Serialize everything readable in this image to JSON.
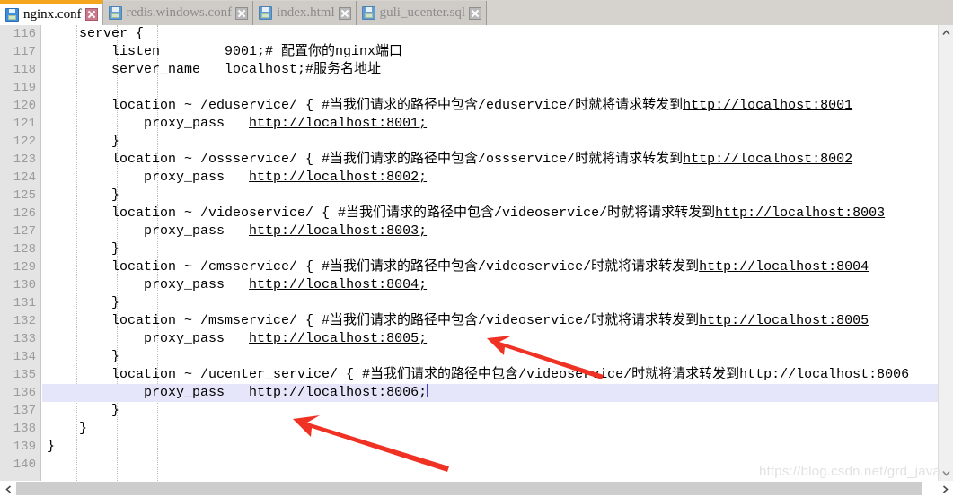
{
  "window": {
    "app": "text-editor",
    "accent_color": "#f5a41d",
    "current_line_highlight": "#e6e6fa"
  },
  "tabs": [
    {
      "label": "nginx.conf",
      "icon": "save-disk-icon",
      "close_icon": "close-icon",
      "active": true
    },
    {
      "label": "redis.windows.conf",
      "icon": "save-disk-icon",
      "close_icon": "close-icon",
      "active": false
    },
    {
      "label": "index.html",
      "icon": "save-disk-icon",
      "close_icon": "close-icon",
      "active": false
    },
    {
      "label": "guli_ucenter.sql",
      "icon": "save-disk-icon",
      "close_icon": "close-icon",
      "active": false
    }
  ],
  "editor": {
    "first_line_number": 116,
    "current_line_number": 136,
    "lines": [
      {
        "n": 116,
        "segments": [
          {
            "t": "    server {"
          }
        ]
      },
      {
        "n": 117,
        "segments": [
          {
            "t": "        listen        9001;# 配置你的nginx端口"
          }
        ]
      },
      {
        "n": 118,
        "segments": [
          {
            "t": "        server_name   localhost;#服务名地址"
          }
        ]
      },
      {
        "n": 119,
        "segments": [
          {
            "t": ""
          }
        ]
      },
      {
        "n": 120,
        "segments": [
          {
            "t": "        location ~ /eduservice/ { #当我们请求的路径中包含/eduservice/时就将请求转发到"
          },
          {
            "t": "http://localhost:8001",
            "link": true
          }
        ]
      },
      {
        "n": 121,
        "segments": [
          {
            "t": "            proxy_pass   "
          },
          {
            "t": "http://localhost:8001;",
            "link": true
          }
        ]
      },
      {
        "n": 122,
        "segments": [
          {
            "t": "        }"
          }
        ]
      },
      {
        "n": 123,
        "segments": [
          {
            "t": "        location ~ /ossservice/ { #当我们请求的路径中包含/ossservice/时就将请求转发到"
          },
          {
            "t": "http://localhost:8002",
            "link": true
          }
        ]
      },
      {
        "n": 124,
        "segments": [
          {
            "t": "            proxy_pass   "
          },
          {
            "t": "http://localhost:8002;",
            "link": true
          }
        ]
      },
      {
        "n": 125,
        "segments": [
          {
            "t": "        }"
          }
        ]
      },
      {
        "n": 126,
        "segments": [
          {
            "t": "        location ~ /videoservice/ { #当我们请求的路径中包含/videoservice/时就将请求转发到"
          },
          {
            "t": "http://localhost:8003",
            "link": true
          }
        ]
      },
      {
        "n": 127,
        "segments": [
          {
            "t": "            proxy_pass   "
          },
          {
            "t": "http://localhost:8003;",
            "link": true
          }
        ]
      },
      {
        "n": 128,
        "segments": [
          {
            "t": "        }"
          }
        ]
      },
      {
        "n": 129,
        "segments": [
          {
            "t": "        location ~ /cmsservice/ { #当我们请求的路径中包含/videoservice/时就将请求转发到"
          },
          {
            "t": "http://localhost:8004",
            "link": true
          }
        ]
      },
      {
        "n": 130,
        "segments": [
          {
            "t": "            proxy_pass   "
          },
          {
            "t": "http://localhost:8004;",
            "link": true
          }
        ]
      },
      {
        "n": 131,
        "segments": [
          {
            "t": "        }"
          }
        ]
      },
      {
        "n": 132,
        "segments": [
          {
            "t": "        location ~ /msmservice/ { #当我们请求的路径中包含/videoservice/时就将请求转发到"
          },
          {
            "t": "http://localhost:8005",
            "link": true
          }
        ]
      },
      {
        "n": 133,
        "segments": [
          {
            "t": "            proxy_pass   "
          },
          {
            "t": "http://localhost:8005;",
            "link": true
          }
        ]
      },
      {
        "n": 134,
        "segments": [
          {
            "t": "        }"
          }
        ]
      },
      {
        "n": 135,
        "segments": [
          {
            "t": "        location ~ /ucenter_service/ { #当我们请求的路径中包含/videoservice/时就将请求转发到"
          },
          {
            "t": "http://localhost:8006",
            "link": true
          }
        ]
      },
      {
        "n": 136,
        "segments": [
          {
            "t": "            proxy_pass   "
          },
          {
            "t": "http://localhost:8006;",
            "link": true
          }
        ],
        "current": true,
        "caret_at_end": true
      },
      {
        "n": 137,
        "segments": [
          {
            "t": "        }"
          }
        ]
      },
      {
        "n": 138,
        "segments": [
          {
            "t": "    }"
          }
        ]
      },
      {
        "n": 139,
        "segments": [
          {
            "t": "}"
          }
        ]
      },
      {
        "n": 140,
        "segments": [
          {
            "t": ""
          }
        ]
      }
    ]
  },
  "scrollbars": {
    "vertical": {
      "up_arrow_icon": "chevron-up-icon",
      "down_arrow_icon": "chevron-down-icon"
    },
    "horizontal": {
      "left_arrow_icon": "chevron-left-icon",
      "right_arrow_icon": "chevron-right-icon"
    }
  },
  "annotations": [
    {
      "name": "arrow-to-line-133",
      "color": "#f03224"
    },
    {
      "name": "arrow-to-line-136",
      "color": "#f03224"
    }
  ],
  "watermark": {
    "text": "https://blog.csdn.net/grd_java"
  }
}
